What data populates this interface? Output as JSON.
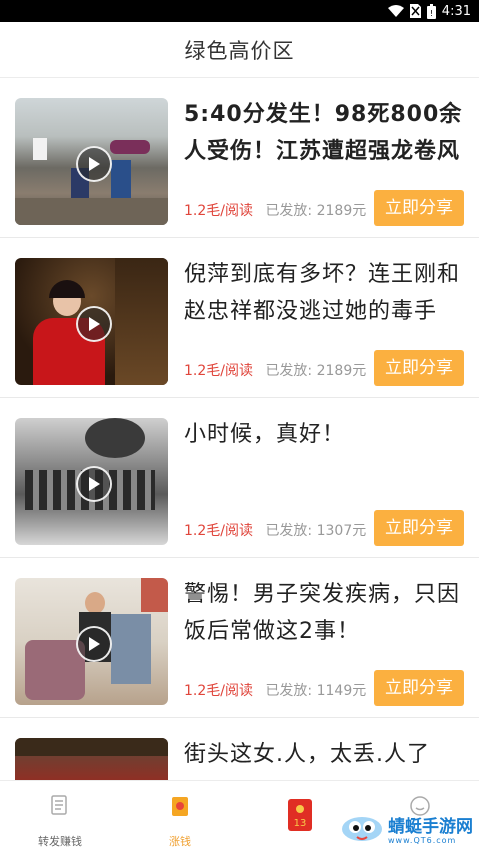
{
  "status_bar": {
    "time": "4:31"
  },
  "header": {
    "title": "绿色高价区"
  },
  "articles": [
    {
      "title": "5:40分发生！98死800余人受伤！江苏遭超强龙卷风",
      "price": "1.2毛/阅读",
      "sent": "已发放: 2189元",
      "share_label": "立即分享"
    },
    {
      "title": "倪萍到底有多坏？连王刚和赵忠祥都没逃过她的毒手",
      "price": "1.2毛/阅读",
      "sent": "已发放: 2189元",
      "share_label": "立即分享"
    },
    {
      "title": "小时候，真好！",
      "price": "1.2毛/阅读",
      "sent": "已发放: 1307元",
      "share_label": "立即分享"
    },
    {
      "title": "警惕！男子突发疾病，只因饭后常做这2事！",
      "price": "1.2毛/阅读",
      "sent": "已发放: 1149元",
      "share_label": "立即分享"
    },
    {
      "title": "街头这女.人，太丢.人了"
    }
  ],
  "tabbar": {
    "tabs": [
      {
        "label": "转发赚钱"
      },
      {
        "label": "涨钱"
      },
      {
        "label": ""
      },
      {
        "label": ""
      }
    ],
    "red_packet_number": "13"
  },
  "watermark": {
    "name": "蜻蜓手游网",
    "site": "www.QT6.com"
  },
  "colors": {
    "accent": "#fbb040",
    "price": "#e0453b",
    "active_tab": "#f0a030"
  }
}
